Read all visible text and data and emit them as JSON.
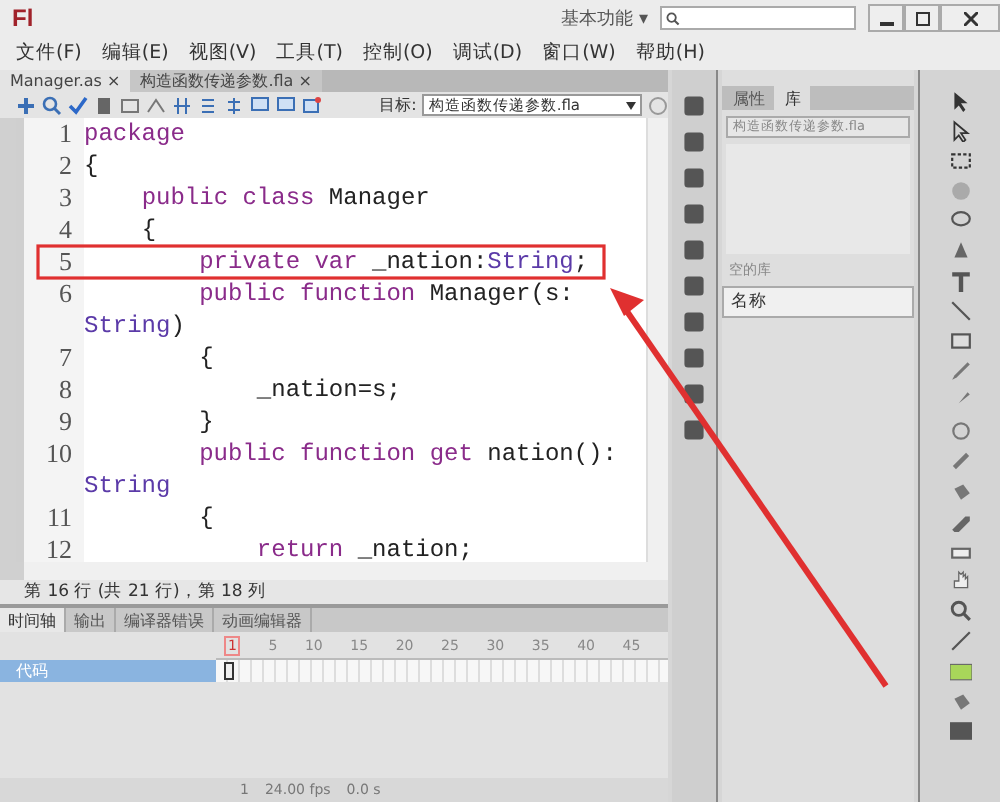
{
  "app": {
    "logo": "Fl",
    "workspace": "基本功能",
    "workspace_caret": "▾"
  },
  "menu": [
    "文件(F)",
    "编辑(E)",
    "视图(V)",
    "工具(T)",
    "控制(O)",
    "调试(D)",
    "窗口(W)",
    "帮助(H)"
  ],
  "doc_tabs": [
    {
      "label": "Manager.as",
      "selected": true,
      "close": "×"
    },
    {
      "label": "构造函数传递参数.fla",
      "selected": false,
      "close": "×"
    }
  ],
  "target": {
    "label": "目标:",
    "value": "构造函数传递参数.fla"
  },
  "code_lines": [
    {
      "number": "1",
      "tokens": [
        {
          "kind": "keyword",
          "text": "package"
        }
      ]
    },
    {
      "number": "2",
      "tokens": [
        {
          "kind": "plain",
          "text": "{"
        }
      ]
    },
    {
      "number": "3",
      "tokens": [
        {
          "kind": "keyword",
          "text": "    public class"
        },
        {
          "kind": "plain",
          "text": " Manager"
        }
      ]
    },
    {
      "number": "4",
      "tokens": [
        {
          "kind": "plain",
          "text": "    {"
        }
      ]
    },
    {
      "number": "5",
      "tokens": [
        {
          "kind": "keyword",
          "text": "        private var"
        },
        {
          "kind": "plain",
          "text": " _nation:"
        },
        {
          "kind": "type",
          "text": "String"
        },
        {
          "kind": "plain",
          "text": ";"
        }
      ]
    },
    {
      "number": "6",
      "tokens": [
        {
          "kind": "keyword",
          "text": "        public function"
        },
        {
          "kind": "plain",
          "text": " Manager(s:"
        }
      ]
    },
    {
      "tokens": [
        {
          "kind": "type",
          "text": "String"
        },
        {
          "kind": "plain",
          "text": ")"
        }
      ]
    },
    {
      "number": "7",
      "tokens": [
        {
          "kind": "plain",
          "text": "        {"
        }
      ]
    },
    {
      "number": "8",
      "tokens": [
        {
          "kind": "plain",
          "text": "            _nation=s;"
        }
      ]
    },
    {
      "number": "9",
      "tokens": [
        {
          "kind": "plain",
          "text": "        }"
        }
      ]
    },
    {
      "number": "10",
      "tokens": [
        {
          "kind": "keyword",
          "text": "        public function get"
        },
        {
          "kind": "plain",
          "text": " nation():"
        }
      ]
    },
    {
      "tokens": [
        {
          "kind": "type",
          "text": "String"
        }
      ]
    },
    {
      "number": "11",
      "tokens": [
        {
          "kind": "plain",
          "text": "        {"
        }
      ]
    },
    {
      "number": "12",
      "tokens": [
        {
          "kind": "keyword",
          "text": "            return"
        },
        {
          "kind": "plain",
          "text": " _nation;"
        }
      ]
    }
  ],
  "status": "第 16 行 (共 21 行)，第 18 列",
  "timeline": {
    "tabs": [
      {
        "label": "时间轴",
        "selected": true
      },
      {
        "label": "输出",
        "selected": false
      },
      {
        "label": "编译器错误",
        "selected": false
      },
      {
        "label": "动画编辑器",
        "selected": false
      }
    ],
    "frame_numbers": [
      "1",
      "5",
      "10",
      "15",
      "20",
      "25",
      "30",
      "35",
      "40",
      "45"
    ],
    "layers": [
      {
        "name": "代码",
        "selected": true
      }
    ],
    "current_frame": "1",
    "fps": "24.00 fps",
    "time": "0.0 s"
  },
  "library_panel": {
    "tabs": [
      {
        "label": "属性",
        "selected": false
      },
      {
        "label": "库",
        "selected": true
      }
    ],
    "document": "构造函数传递参数.fla",
    "empty_text": "空的库",
    "column": "名称"
  }
}
